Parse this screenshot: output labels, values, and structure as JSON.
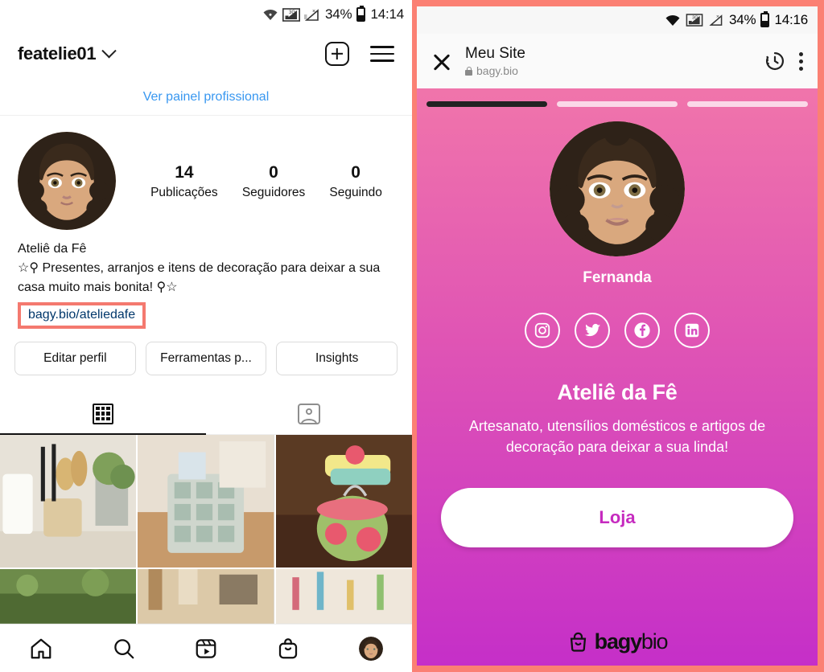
{
  "left_app": {
    "status_bar": {
      "battery_percent": "34%",
      "time": "14:14",
      "icons": [
        "wifi-icon",
        "signal-3g-icon",
        "signal-empty-icon",
        "battery-icon"
      ]
    },
    "header": {
      "username": "featelie01",
      "dropdown_icon": "chevron-down-icon",
      "new_post_icon": "plus-square-icon",
      "menu_icon": "hamburger-menu-icon"
    },
    "professional_panel_link": "Ver painel profissional",
    "stats": [
      {
        "num": "14",
        "label": "Publicações"
      },
      {
        "num": "0",
        "label": "Seguidores"
      },
      {
        "num": "0",
        "label": "Seguindo"
      }
    ],
    "bio": {
      "display_name": "Ateliê da Fê",
      "text": "☆⚲ Presentes, arranjos e itens de decoração para deixar a sua casa muito mais bonita! ⚲☆",
      "link": "bagy.bio/ateliedafe",
      "link_highlight_color": "#f4796f",
      "link_color": "#00376b"
    },
    "buttons": [
      "Editar perfil",
      "Ferramentas p...",
      "Insights"
    ],
    "tabs": [
      {
        "name": "grid-tab",
        "icon": "grid-icon",
        "active": true
      },
      {
        "name": "tagged-tab",
        "icon": "tagged-person-icon",
        "active": false
      }
    ],
    "bottom_nav": [
      "home-icon",
      "search-icon",
      "reels-icon",
      "shop-icon",
      "profile-avatar"
    ],
    "accent_link_color": "#3897f0"
  },
  "right_app": {
    "status_bar": {
      "battery_percent": "34%",
      "time": "14:16"
    },
    "browser_bar": {
      "close_icon": "close-icon",
      "title": "Meu Site",
      "url": "bagy.bio",
      "lock_icon": "lock-icon",
      "history_icon": "history-clock-icon",
      "menu_icon": "vertical-dots-icon"
    },
    "progress_bars": [
      {
        "active": true
      },
      {
        "active": false
      },
      {
        "active": false
      }
    ],
    "page": {
      "profile_name": "Fernanda",
      "socials": [
        "instagram-icon",
        "twitter-icon",
        "facebook-icon",
        "linkedin-icon"
      ],
      "title": "Ateliê da Fê",
      "description": "Artesanato, utensílios domésticos e artigos de decoração para deixar a sua linda!",
      "cta_label": "Loja",
      "footer_logo": "bagy",
      "footer_logo_thin": "bio"
    },
    "colors": {
      "border": "#fb8073",
      "gradient_top": "#f67fa8",
      "gradient_bottom": "#c52fc8",
      "cta_text": "#c62bbf"
    }
  }
}
